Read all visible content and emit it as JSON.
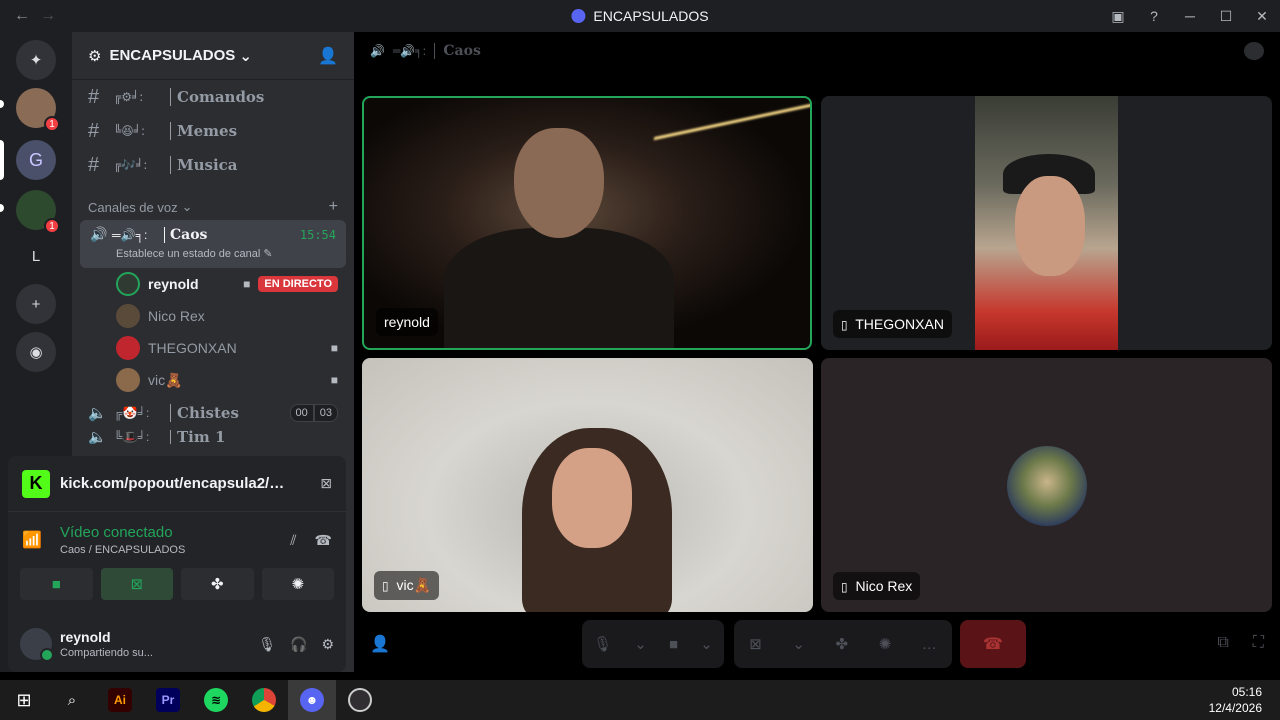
{
  "window": {
    "title": "ENCAPSULADOS"
  },
  "rail": {
    "items": [
      {
        "name": "server-1",
        "badge": "1"
      },
      {
        "name": "server-encapsulados"
      },
      {
        "name": "server-3",
        "badge": "1"
      },
      {
        "name": "server-l",
        "label": "L"
      }
    ]
  },
  "server": {
    "name": "ENCAPSULADOS"
  },
  "channels": {
    "text": [
      {
        "name": "Comandos",
        "deco": "╔⚙╛:"
      },
      {
        "name": "Memes",
        "deco": "╚😆╛:"
      },
      {
        "name": "Musica",
        "deco": "╔🎶╛:"
      }
    ],
    "voice_category": "Canales de voz",
    "active_voice": {
      "name": "Caos",
      "deco": "═🔊╕:",
      "time": "15:54",
      "status": "Establece un estado de canal"
    },
    "members": [
      {
        "name": "reynold",
        "live": "EN DIRECTO",
        "color": "#2e3a32"
      },
      {
        "name": "Nico Rex",
        "color": "#5a4a3a"
      },
      {
        "name": "THEGONXAN",
        "color": "#c0262d"
      },
      {
        "name": "vic🧸",
        "color": "#8a6a4a"
      }
    ],
    "other_voice": {
      "name": "Chistes",
      "deco": "╔🤡╛:",
      "count_a": "00",
      "count_b": "03"
    },
    "partial": {
      "name": "Tim 1",
      "deco": "╚🎩╛:"
    }
  },
  "activity": {
    "url": "kick.com/popout/encapsula2/c...",
    "voice_status": "Vídeo conectado",
    "voice_location": "Caos / ENCAPSULADOS"
  },
  "user": {
    "name": "reynold",
    "status": "Compartiendo su..."
  },
  "main": {
    "channel_name": "Caos",
    "channel_deco": "═🔊╕:",
    "tiles": [
      {
        "name": "reynold",
        "device": ""
      },
      {
        "name": "THEGONXAN",
        "device": "▯"
      },
      {
        "name": "vic🧸",
        "device": "▯"
      },
      {
        "name": "Nico Rex",
        "device": "▯"
      }
    ]
  },
  "taskbar": {
    "time": "05:16",
    "date": "12/4/2026",
    "apps": [
      "windows-start",
      "search",
      "illustrator",
      "premiere",
      "spotify",
      "chrome",
      "discord",
      "obs"
    ]
  },
  "colors": {
    "accent_green": "#23a55a",
    "live_red": "#da373c",
    "brand": "#5865f2"
  }
}
